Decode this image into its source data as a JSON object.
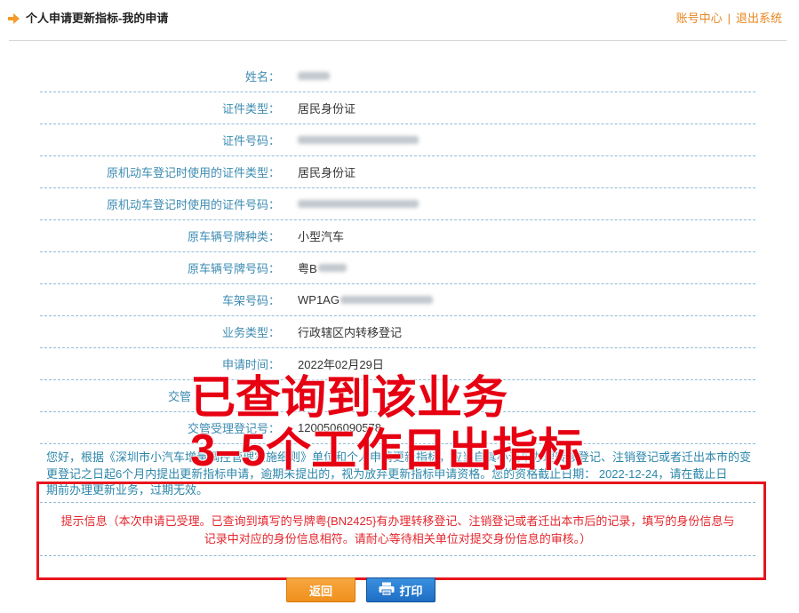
{
  "header": {
    "title": "个人申请更新指标-我的申请",
    "account_link": "账号中心",
    "separator": "|",
    "logout_link": "退出系统",
    "icon": "arrow-right-icon"
  },
  "form": {
    "rows": [
      {
        "label": "姓名："
      },
      {
        "label": "证件类型：",
        "value": "居民身份证"
      },
      {
        "label": "证件号码："
      },
      {
        "label": "原机动车登记时使用的证件类型：",
        "value": "居民身份证"
      },
      {
        "label": "原机动车登记时使用的证件号码："
      },
      {
        "label": "原车辆号牌种类：",
        "value": "小型汽车"
      },
      {
        "label": "原车辆号牌号码：",
        "value": "粤B"
      },
      {
        "label": "车架号码：",
        "value": "WP1AG"
      },
      {
        "label": "业务类型：",
        "value": "行政辖区内转移登记"
      },
      {
        "label": "申请时间：",
        "value": "2022年02月29日"
      },
      {
        "label": "交管"
      },
      {
        "label": "交管受理登记号：",
        "value": "1200506090578"
      }
    ]
  },
  "notice": {
    "lines": [
      "您好，根据《深圳市小汽车增量调控管理实施细则》单位和个人申请更新指标，应当自其小汽车办理转移登记、注销登记或者迁出本市的变",
      "更登记之日起6个月内提出更新指标申请，逾期未提出的，视为放弃更新指标申请资格。您的资格截止日期： 2022-12-24，请在截止日",
      "期前办理更新业务，过期无效。"
    ]
  },
  "tip": {
    "lines": [
      "提示信息（本次申请已受理。已查询到填写的号牌粤{BN2425}有办理转移登记、注销登记或者迁出本市后的记录，填写的身份信息与",
      "记录中对应的身份信息相符。请耐心等待相关单位对提交身份信息的审核。）"
    ]
  },
  "buttons": {
    "return_label": "返回",
    "print_label": "打印",
    "print_icon": "printer-icon"
  },
  "overlay": {
    "line1": "已查询到该业务",
    "line2": "3–5个工作日出指标"
  },
  "colors": {
    "label": "#3d8bb1",
    "orange": "#e8861f",
    "red": "#e60012",
    "tip": "#e3262d",
    "dash": "#8dbad6",
    "para": "#2d86aa",
    "return_button": "#f0901c",
    "print_button": "#1e6fc5"
  }
}
